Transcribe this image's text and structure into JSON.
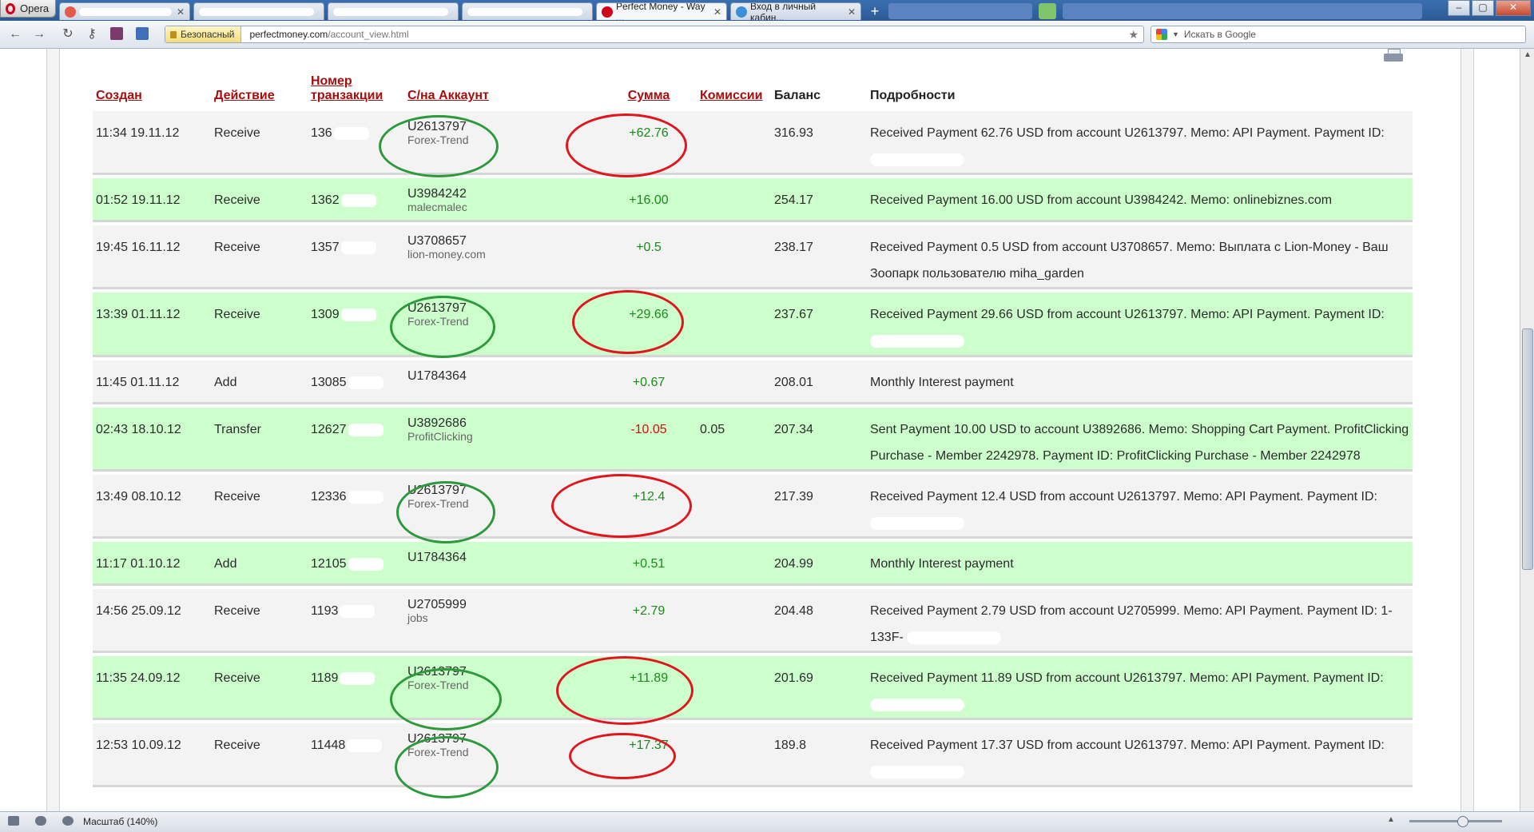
{
  "browser": {
    "opera_label": "Opera",
    "tabs": [
      {
        "title": "",
        "active": false
      },
      {
        "title": "",
        "active": false
      },
      {
        "title": "",
        "active": false
      },
      {
        "title": "",
        "active": false
      },
      {
        "title": "Perfect Money - Way ...",
        "active": true
      },
      {
        "title": "Вход в личный кабин...",
        "active": false
      }
    ],
    "secure_label": "Безопасный",
    "url_host": "perfectmoney.com",
    "url_path": "/account_view.html",
    "search_placeholder": "Искать в Google"
  },
  "table": {
    "headers": {
      "created": "Создан",
      "action": "Действие",
      "txn_line1": "Номер",
      "txn_line2": "транзакции",
      "account": "С/на Аккаунт",
      "amount": "Сумма",
      "fee": "Комиссии",
      "balance": "Баланс",
      "details": "Подробности"
    },
    "rows": [
      {
        "created": "11:34 19.11.12",
        "action": "Receive",
        "txn": "136",
        "account": "U2613797",
        "account_sub": "Forex-Trend",
        "amount": "+62.76",
        "fee": "",
        "balance": "316.93",
        "details": "Received Payment 62.76 USD from account U2613797. Memo: API Payment. Payment ID:"
      },
      {
        "created": "01:52 19.11.12",
        "action": "Receive",
        "txn": "1362",
        "account": "U3984242",
        "account_sub": "malecmalec",
        "amount": "+16.00",
        "fee": "",
        "balance": "254.17",
        "details": "Received Payment 16.00 USD from account U3984242. Memo: onlinebiznes.com"
      },
      {
        "created": "19:45 16.11.12",
        "action": "Receive",
        "txn": "1357",
        "account": "U3708657",
        "account_sub": "lion-money.com",
        "amount": "+0.5",
        "fee": "",
        "balance": "238.17",
        "details": "Received Payment 0.5 USD from account U3708657. Memo: Выплата с Lion-Money - Ваш Зоопарк пользователю miha_garden"
      },
      {
        "created": "13:39 01.11.12",
        "action": "Receive",
        "txn": "1309",
        "account": "U2613797",
        "account_sub": "Forex-Trend",
        "amount": "+29.66",
        "fee": "",
        "balance": "237.67",
        "details": "Received Payment 29.66 USD from account U2613797. Memo: API Payment. Payment ID:"
      },
      {
        "created": "11:45 01.11.12",
        "action": "Add",
        "txn": "13085",
        "account": "U1784364",
        "account_sub": "",
        "amount": "+0.67",
        "fee": "",
        "balance": "208.01",
        "details": "Monthly Interest payment"
      },
      {
        "created": "02:43 18.10.12",
        "action": "Transfer",
        "txn": "12627",
        "account": "U3892686",
        "account_sub": "ProfitClicking",
        "amount": "-10.05",
        "fee": "0.05",
        "balance": "207.34",
        "details": "Sent Payment 10.00 USD to account U3892686. Memo: Shopping Cart Payment. ProfitClicking Purchase - Member 2242978. Payment ID: ProfitClicking Purchase - Member 2242978"
      },
      {
        "created": "13:49 08.10.12",
        "action": "Receive",
        "txn": "12336",
        "account": "U2613797",
        "account_sub": "Forex-Trend",
        "amount": "+12.4",
        "fee": "",
        "balance": "217.39",
        "details": "Received Payment 12.4 USD from account U2613797. Memo: API Payment. Payment ID:"
      },
      {
        "created": "11:17 01.10.12",
        "action": "Add",
        "txn": "12105",
        "account": "U1784364",
        "account_sub": "",
        "amount": "+0.51",
        "fee": "",
        "balance": "204.99",
        "details": "Monthly Interest payment"
      },
      {
        "created": "14:56 25.09.12",
        "action": "Receive",
        "txn": "1193",
        "account": "U2705999",
        "account_sub": "jobs",
        "amount": "+2.79",
        "fee": "",
        "balance": "204.48",
        "details": "Received Payment 2.79 USD from account U2705999. Memo: API Payment. Payment ID: 1-133F-"
      },
      {
        "created": "11:35 24.09.12",
        "action": "Receive",
        "txn": "1189",
        "account": "U2613797",
        "account_sub": "Forex-Trend",
        "amount": "+11.89",
        "fee": "",
        "balance": "201.69",
        "details": "Received Payment 11.89 USD from account U2613797. Memo: API Payment. Payment ID:"
      },
      {
        "created": "12:53 10.09.12",
        "action": "Receive",
        "txn": "11448",
        "account": "U2613797",
        "account_sub": "Forex-Trend",
        "amount": "+17.37",
        "fee": "",
        "balance": "189.8",
        "details": "Received Payment 17.37 USD from account U2613797. Memo: API Payment. Payment ID:"
      }
    ]
  },
  "statusbar": {
    "zoom_label": "Масштаб (140%)"
  },
  "colors": {
    "row_green": "#ccffcc",
    "row_gray": "#f3f3f3",
    "header_link": "#a50d0d",
    "positive": "#1a8a1a",
    "negative": "#d01010",
    "ring_green": "#2c9a3b",
    "ring_red": "#e0161c"
  }
}
